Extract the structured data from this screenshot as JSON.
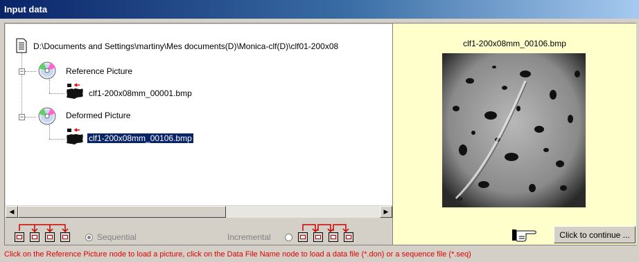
{
  "window": {
    "title": "Input data"
  },
  "tree": {
    "root_path": "D:\\Documents and Settings\\martiny\\Mes documents(D)\\Monica-clf(D)\\clf01-200x08",
    "reference": {
      "label": "Reference Picture",
      "file": "clf1-200x08mm_00001.bmp"
    },
    "deformed": {
      "label": "Deformed Picture",
      "file": "clf1-200x08mm_00106.bmp",
      "selected": true
    }
  },
  "preview": {
    "filename": "clf1-200x08mm_00106.bmp"
  },
  "controls": {
    "sequential_label": "Sequential",
    "incremental_label": "Incremental",
    "continue_label": "Click to continue ..."
  },
  "status_text": "Click on the Reference Picture node to load a picture, click on the Data File Name node to load a data file (*.don) or a sequence file (*.seq)",
  "icons": [
    "document-icon",
    "cd-icon",
    "bitmap-file-icon",
    "hand-pointer-icon",
    "frame-toolbar-icon"
  ],
  "colors": {
    "title_start": "#0a246a",
    "title_end": "#a6caf0",
    "selection": "#0a246a",
    "status": "#e00000",
    "preview_bg": "#ffffcc"
  }
}
